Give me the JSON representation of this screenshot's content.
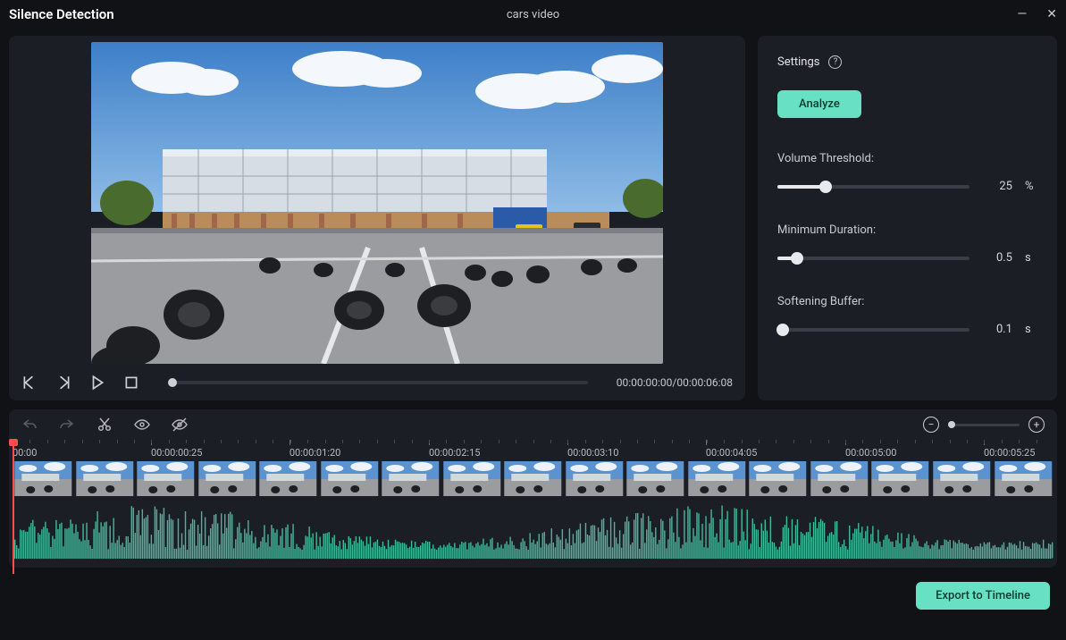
{
  "window": {
    "title": "Silence Detection",
    "filename": "cars video"
  },
  "player": {
    "timecode": "00:00:00:00/00:00:06:08"
  },
  "settings": {
    "heading": "Settings",
    "analyze_label": "Analyze",
    "sliders": [
      {
        "label": "Volume Threshold:",
        "value": "25",
        "unit": "%",
        "pct": 25
      },
      {
        "label": "Minimum Duration:",
        "value": "0.5",
        "unit": "s",
        "pct": 10
      },
      {
        "label": "Softening Buffer:",
        "value": "0.1",
        "unit": "s",
        "pct": 3
      }
    ]
  },
  "ruler": [
    {
      "label": "00:00",
      "pct": 0
    },
    {
      "label": "00:00:00:25",
      "pct": 13.3
    },
    {
      "label": "00:00:01:20",
      "pct": 26.6
    },
    {
      "label": "00:00:02:15",
      "pct": 40
    },
    {
      "label": "00:00:03:10",
      "pct": 53.3
    },
    {
      "label": "00:00:04:05",
      "pct": 66.6
    },
    {
      "label": "00:00:05:00",
      "pct": 80
    },
    {
      "label": "00:00:05:25",
      "pct": 93.3
    }
  ],
  "footer": {
    "export_label": "Export to Timeline"
  }
}
